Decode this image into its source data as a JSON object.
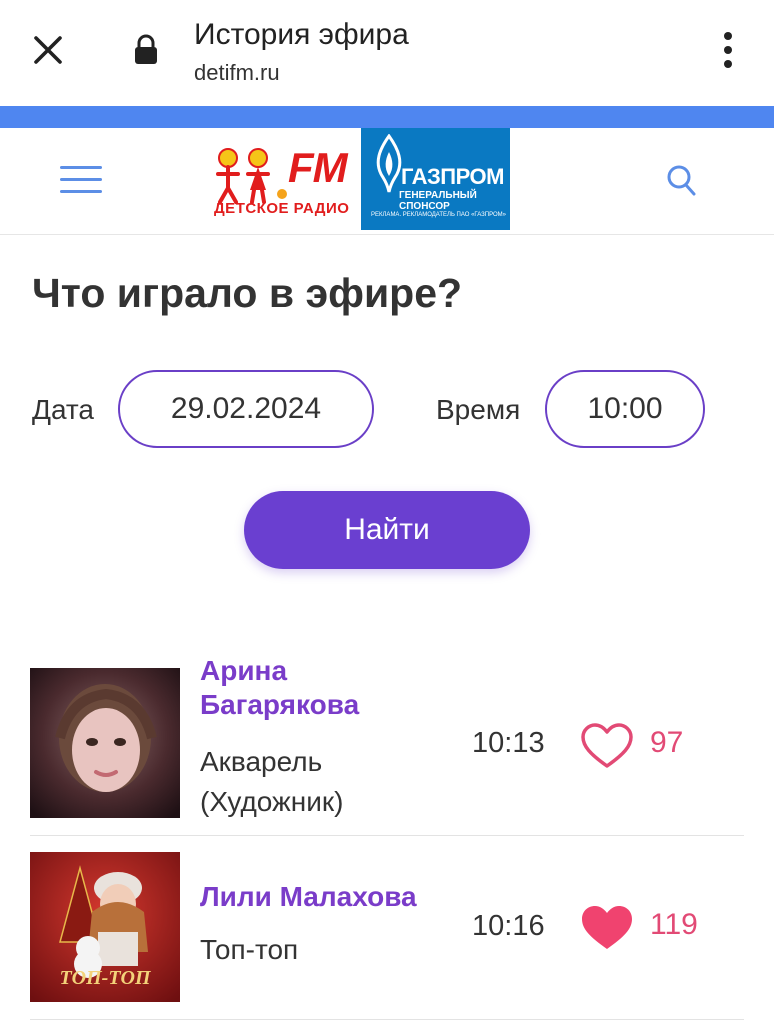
{
  "browser": {
    "title": "История эфира",
    "url": "detifm.ru"
  },
  "header": {
    "logo_fm": "FM",
    "logo_text": "ДЕТСКОЕ РАДИО",
    "sponsor_name": "ГАЗПРОМ",
    "sponsor_sub": "ГЕНЕРАЛЬНЫЙ СПОНСОР",
    "sponsor_fine": "РЕКЛАМА. РЕКЛАМОДАТЕЛЬ ПАО «ГАЗПРОМ»"
  },
  "colors": {
    "accent": "#6a3fd0",
    "artist": "#7a3cc9",
    "like": "#e24a75",
    "bar": "#4f86f0",
    "sponsor_bg": "#0a79c2"
  },
  "main": {
    "title": "Что играло в эфире?",
    "date_label": "Дата",
    "date_value": "29.02.2024",
    "time_label": "Время",
    "time_value": "10:00",
    "find_button": "Найти"
  },
  "tracks": [
    {
      "artist_line1": "Арина",
      "artist_line2": "Багарякова",
      "song_line1": "Акварель",
      "song_line2": "(Художник)",
      "time": "10:13",
      "likes": "97",
      "liked": false,
      "heart_icon": "heart-outline-icon"
    },
    {
      "artist_line1": "Лили Малахова",
      "song_line1": "Топ-топ",
      "cover_text": "ТОП-ТОП",
      "time": "10:16",
      "likes": "119",
      "liked": true,
      "heart_icon": "heart-filled-icon"
    }
  ]
}
